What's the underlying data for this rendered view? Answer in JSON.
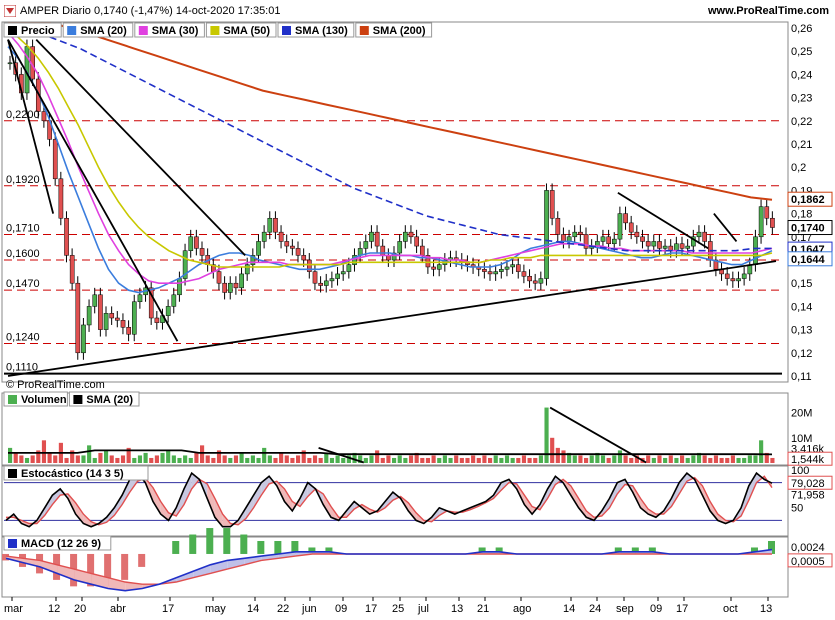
{
  "header": {
    "title": "AMPER Diario 0,1740 (-1,47%) 14-oct-2020 17:35:01",
    "site": "www.ProRealTime.com"
  },
  "colors": {
    "price_up": "#4caf50",
    "price_down": "#e05050",
    "sma20": "#3b7ddd",
    "sma30": "#e040e0",
    "sma50": "#c8c800",
    "sma130": "#2030c8",
    "sma200": "#cc4010",
    "grid_dash": "#cc0000",
    "trend": "#000000"
  },
  "chart_data": [
    {
      "panel": "price",
      "type": "line",
      "legend": [
        "Precio",
        "SMA (20)",
        "SMA (30)",
        "SMA (50)",
        "SMA (130)",
        "SMA (200)"
      ],
      "ylim": [
        0.11,
        0.26
      ],
      "y_ticks": [
        "0,26",
        "0,25",
        "0,24",
        "0,23",
        "0,22",
        "0,21",
        "0,2",
        "0,19",
        "0,18",
        "0,17",
        "0,16",
        "0,15",
        "0,14",
        "0,13",
        "0,12",
        "0,11"
      ],
      "horizontal_levels": [
        "0,2200",
        "0,1920",
        "0,1710",
        "0,1600",
        "0,1470",
        "0,1240",
        "0,1110"
      ],
      "price_labels": {
        "sma200": "0,1862",
        "last": "0,1740",
        "sma130": "0,1647",
        "sma20": "0,1644"
      },
      "credit": "© ProRealTime.com",
      "series": [
        {
          "name": "Precio",
          "values": [
            0.245,
            0.24,
            0.232,
            0.252,
            0.238,
            0.224,
            0.22,
            0.212,
            0.195,
            0.178,
            0.162,
            0.15,
            0.12,
            0.132,
            0.14,
            0.145,
            0.13,
            0.137,
            0.135,
            0.134,
            0.131,
            0.128,
            0.142,
            0.145,
            0.148,
            0.135,
            0.133,
            0.136,
            0.14,
            0.145,
            0.152,
            0.164,
            0.17,
            0.165,
            0.162,
            0.158,
            0.155,
            0.15,
            0.146,
            0.15,
            0.148,
            0.154,
            0.158,
            0.162,
            0.168,
            0.172,
            0.178,
            0.172,
            0.168,
            0.166,
            0.165,
            0.162,
            0.16,
            0.155,
            0.15,
            0.149,
            0.151,
            0.152,
            0.154,
            0.155,
            0.158,
            0.162,
            0.165,
            0.168,
            0.172,
            0.166,
            0.162,
            0.16,
            0.163,
            0.168,
            0.172,
            0.17,
            0.166,
            0.162,
            0.157,
            0.156,
            0.158,
            0.16,
            0.161,
            0.16,
            0.159,
            0.158,
            0.157,
            0.156,
            0.155,
            0.154,
            0.155,
            0.156,
            0.157,
            0.158,
            0.155,
            0.153,
            0.151,
            0.15,
            0.152,
            0.19,
            0.178,
            0.171,
            0.168,
            0.17,
            0.172,
            0.171,
            0.165,
            0.166,
            0.168,
            0.17,
            0.167,
            0.169,
            0.18,
            0.176,
            0.172,
            0.17,
            0.168,
            0.166,
            0.168,
            0.165,
            0.166,
            0.164,
            0.167,
            0.165,
            0.166,
            0.17,
            0.172,
            0.168,
            0.16,
            0.156,
            0.154,
            0.152,
            0.151,
            0.152,
            0.154,
            0.158,
            0.17,
            0.183,
            0.178,
            0.174
          ]
        },
        {
          "name": "SMA (20)",
          "values": [
            0.252,
            0.247,
            0.24,
            0.232,
            0.222,
            0.21,
            0.198,
            0.187,
            0.176,
            0.165,
            0.156,
            0.15,
            0.147,
            0.146,
            0.147,
            0.148,
            0.15,
            0.152,
            0.155,
            0.158,
            0.16,
            0.162,
            0.163,
            0.163,
            0.162,
            0.16,
            0.159,
            0.158,
            0.157,
            0.156,
            0.156,
            0.156,
            0.157,
            0.158,
            0.16,
            0.162,
            0.163,
            0.163,
            0.163,
            0.162,
            0.162,
            0.161,
            0.161,
            0.16,
            0.159,
            0.158,
            0.157,
            0.157,
            0.157,
            0.158,
            0.16,
            0.163,
            0.165,
            0.166,
            0.167,
            0.168,
            0.168,
            0.167,
            0.166,
            0.165,
            0.164,
            0.163,
            0.162,
            0.161,
            0.161,
            0.162,
            0.163,
            0.163,
            0.162,
            0.161,
            0.16,
            0.159,
            0.158,
            0.158,
            0.16,
            0.162,
            0.164
          ]
        },
        {
          "name": "SMA (30)",
          "values": [
            0.258,
            0.253,
            0.247,
            0.24,
            0.231,
            0.221,
            0.211,
            0.2,
            0.19,
            0.18,
            0.171,
            0.164,
            0.158,
            0.154,
            0.151,
            0.15,
            0.15,
            0.15,
            0.151,
            0.152,
            0.154,
            0.156,
            0.157,
            0.158,
            0.159,
            0.159,
            0.159,
            0.159,
            0.158,
            0.158,
            0.158,
            0.158,
            0.158,
            0.159,
            0.16,
            0.161,
            0.162,
            0.162,
            0.162,
            0.162,
            0.162,
            0.162,
            0.161,
            0.161,
            0.16,
            0.16,
            0.159,
            0.159,
            0.16,
            0.161,
            0.162,
            0.163,
            0.164,
            0.165,
            0.166,
            0.167,
            0.167,
            0.167,
            0.166,
            0.166,
            0.165,
            0.165,
            0.164,
            0.164,
            0.164,
            0.164,
            0.164,
            0.164,
            0.163,
            0.163,
            0.163,
            0.163,
            0.163,
            0.163,
            0.163,
            0.164,
            0.165
          ]
        },
        {
          "name": "SMA (50)",
          "values": [
            0.26,
            0.256,
            0.252,
            0.247,
            0.241,
            0.234,
            0.226,
            0.218,
            0.209,
            0.2,
            0.192,
            0.185,
            0.179,
            0.174,
            0.17,
            0.167,
            0.164,
            0.162,
            0.16,
            0.159,
            0.158,
            0.157,
            0.157,
            0.157,
            0.157,
            0.157,
            0.157,
            0.157,
            0.158,
            0.158,
            0.158,
            0.158,
            0.158,
            0.158,
            0.159,
            0.159,
            0.159,
            0.159,
            0.159,
            0.159,
            0.159,
            0.159,
            0.159,
            0.159,
            0.159,
            0.159,
            0.159,
            0.159,
            0.16,
            0.16,
            0.161,
            0.161,
            0.161,
            0.162,
            0.162,
            0.162,
            0.162,
            0.162,
            0.162,
            0.162,
            0.162,
            0.162,
            0.162,
            0.162,
            0.162,
            0.162,
            0.162,
            0.162,
            0.162,
            0.162,
            0.162,
            0.162,
            0.162,
            0.162,
            0.162,
            0.162,
            0.163
          ]
        },
        {
          "name": "SMA (130)",
          "values": [
            0.262,
            0.26,
            0.257,
            0.254,
            0.251,
            0.247,
            0.243,
            0.239,
            0.235,
            0.231,
            0.227,
            0.223,
            0.219,
            0.215,
            0.211,
            0.207,
            0.203,
            0.199,
            0.195,
            0.191,
            0.188,
            0.185,
            0.182,
            0.179,
            0.177,
            0.175,
            0.173,
            0.171,
            0.17,
            0.169,
            0.168,
            0.167,
            0.166,
            0.165,
            0.164,
            0.164,
            0.164,
            0.164,
            0.164,
            0.164,
            0.164,
            0.165,
            0.165
          ]
        },
        {
          "name": "SMA (200)",
          "values": [
            0.27,
            0.266,
            0.263,
            0.26,
            0.257,
            0.254,
            0.251,
            0.248,
            0.245,
            0.242,
            0.239,
            0.236,
            0.233,
            0.231,
            0.229,
            0.227,
            0.225,
            0.223,
            0.221,
            0.219,
            0.217,
            0.215,
            0.213,
            0.211,
            0.209,
            0.207,
            0.205,
            0.203,
            0.201,
            0.199,
            0.197,
            0.195,
            0.193,
            0.191,
            0.189,
            0.187,
            0.186
          ]
        }
      ]
    },
    {
      "panel": "volume",
      "type": "bar",
      "legend": [
        "Volumen",
        "SMA (20)"
      ],
      "y_ticks": [
        "20M",
        "10M"
      ],
      "price_labels": {
        "last": "1,544k",
        "sma20": "3,416k"
      },
      "values_millions": [
        6,
        4,
        3,
        2,
        3,
        5,
        9,
        4,
        3,
        8,
        2,
        5,
        3,
        3,
        7,
        2,
        4,
        5,
        3,
        2,
        3,
        6,
        2,
        3,
        4,
        2,
        3,
        4,
        5,
        3,
        2,
        3,
        2,
        4,
        7,
        3,
        2,
        5,
        3,
        2,
        3,
        4,
        2,
        3,
        2,
        6,
        3,
        2,
        4,
        3,
        2,
        3,
        5,
        2,
        3,
        2,
        4,
        2,
        3,
        2,
        3,
        4,
        3,
        2,
        3,
        5,
        2,
        3,
        2,
        3,
        2,
        3,
        4,
        2,
        2,
        3,
        2,
        3,
        2,
        3,
        2,
        2,
        3,
        2,
        3,
        2,
        3,
        2,
        3,
        2,
        2,
        3,
        2,
        2,
        3,
        22,
        10,
        6,
        5,
        4,
        3,
        3,
        2,
        3,
        4,
        3,
        2,
        3,
        5,
        3,
        2,
        3,
        2,
        3,
        2,
        3,
        2,
        3,
        2,
        3,
        2,
        3,
        4,
        3,
        2,
        3,
        2,
        2,
        3,
        2,
        2,
        3,
        3,
        9,
        4,
        2
      ],
      "sma_millions": [
        4,
        4,
        4,
        4,
        4,
        5,
        5,
        5,
        5,
        5,
        5,
        4,
        4,
        4,
        4,
        4,
        4,
        4,
        4,
        3.5,
        3.5,
        3.5,
        3.5,
        3.5,
        3.5,
        3.5,
        3.5,
        3.5,
        3.5,
        3.5,
        3.5,
        3.5,
        3.5,
        3.5,
        3.5,
        3.5,
        3.5,
        3.5,
        3.5,
        3.5,
        3.5,
        3.5,
        3.5,
        3.5,
        3.4
      ]
    },
    {
      "panel": "stochastic",
      "type": "line",
      "legend": [
        "Estocástico (14 3 5)"
      ],
      "y_ticks": [
        "100",
        "50"
      ],
      "price_labels": {
        "k": "79,028",
        "d": "71,958"
      },
      "series": [
        {
          "name": "K",
          "values": [
            20,
            30,
            15,
            10,
            20,
            40,
            60,
            70,
            55,
            30,
            15,
            10,
            15,
            25,
            40,
            60,
            85,
            95,
            80,
            50,
            30,
            20,
            40,
            70,
            95,
            85,
            55,
            25,
            10,
            10,
            20,
            40,
            60,
            80,
            90,
            75,
            50,
            35,
            55,
            80,
            70,
            45,
            25,
            20,
            35,
            50,
            40,
            30,
            35,
            50,
            65,
            55,
            35,
            20,
            15,
            25,
            40,
            35,
            30,
            35,
            40,
            45,
            50,
            60,
            80,
            85,
            70,
            45,
            30,
            45,
            70,
            90,
            80,
            60,
            40,
            25,
            20,
            35,
            55,
            80,
            85,
            65,
            40,
            30,
            25,
            35,
            55,
            80,
            95,
            85,
            60,
            35,
            20,
            15,
            20,
            40,
            75,
            95,
            85,
            79
          ]
        },
        {
          "name": "D",
          "values": [
            25,
            25,
            20,
            15,
            15,
            28,
            45,
            60,
            62,
            48,
            30,
            18,
            13,
            17,
            28,
            45,
            65,
            82,
            87,
            72,
            50,
            32,
            27,
            45,
            70,
            85,
            78,
            55,
            30,
            15,
            13,
            23,
            40,
            60,
            78,
            82,
            70,
            50,
            42,
            58,
            70,
            62,
            42,
            25,
            25,
            38,
            45,
            38,
            33,
            40,
            52,
            58,
            48,
            32,
            20,
            18,
            28,
            35,
            33,
            33,
            37,
            42,
            48,
            55,
            68,
            80,
            78,
            60,
            42,
            37,
            55,
            77,
            85,
            75,
            55,
            35,
            25,
            27,
            40,
            62,
            77,
            75,
            55,
            38,
            30,
            30,
            42,
            62,
            82,
            88,
            75,
            50,
            30,
            20,
            18,
            27,
            52,
            80,
            90,
            72
          ]
        }
      ]
    },
    {
      "panel": "macd",
      "type": "line",
      "legend": [
        "MACD (12 26 9)"
      ],
      "price_labels": {
        "macd": "0,0024",
        "signal": "0,0005"
      },
      "series": [
        {
          "name": "MACD",
          "values": [
            -0.002,
            -0.004,
            -0.006,
            -0.009,
            -0.012,
            -0.014,
            -0.016,
            -0.017,
            -0.016,
            -0.014,
            -0.011,
            -0.008,
            -0.005,
            -0.003,
            -0.002,
            -0.001,
            0.0,
            0.001,
            0.001,
            0.001,
            0.0,
            0.0,
            0.0,
            0.0,
            0.0,
            0.0,
            0.0,
            0.0,
            0.001,
            0.001,
            0.0,
            0.0,
            0.0,
            0.0,
            0.0,
            0.0,
            0.001,
            0.001,
            0.001,
            0.0,
            0.0,
            0.0,
            0.0,
            0.0,
            0.001,
            0.002
          ]
        },
        {
          "name": "Signal",
          "values": [
            -0.001,
            -0.002,
            -0.003,
            -0.005,
            -0.007,
            -0.009,
            -0.011,
            -0.013,
            -0.014,
            -0.014,
            -0.013,
            -0.011,
            -0.009,
            -0.007,
            -0.005,
            -0.003,
            -0.002,
            -0.001,
            0.0,
            0.0,
            0.0,
            0.0,
            0.0,
            0.0,
            0.0,
            0.0,
            0.0,
            0.0,
            0.0,
            0.0,
            0.0,
            0.0,
            0.0,
            0.0,
            0.0,
            0.0,
            0.0,
            0.0,
            0.0,
            0.0,
            0.0,
            0.0,
            0.0,
            0.0,
            0.0,
            0.0
          ]
        }
      ]
    }
  ],
  "x_axis": {
    "labels": [
      "mar",
      "12",
      "20",
      "abr",
      "17",
      "may",
      "14",
      "22",
      "jun",
      "09",
      "17",
      "25",
      "jul",
      "13",
      "21",
      "ago",
      "14",
      "24",
      "sep",
      "09",
      "17",
      "oct",
      "13"
    ]
  }
}
